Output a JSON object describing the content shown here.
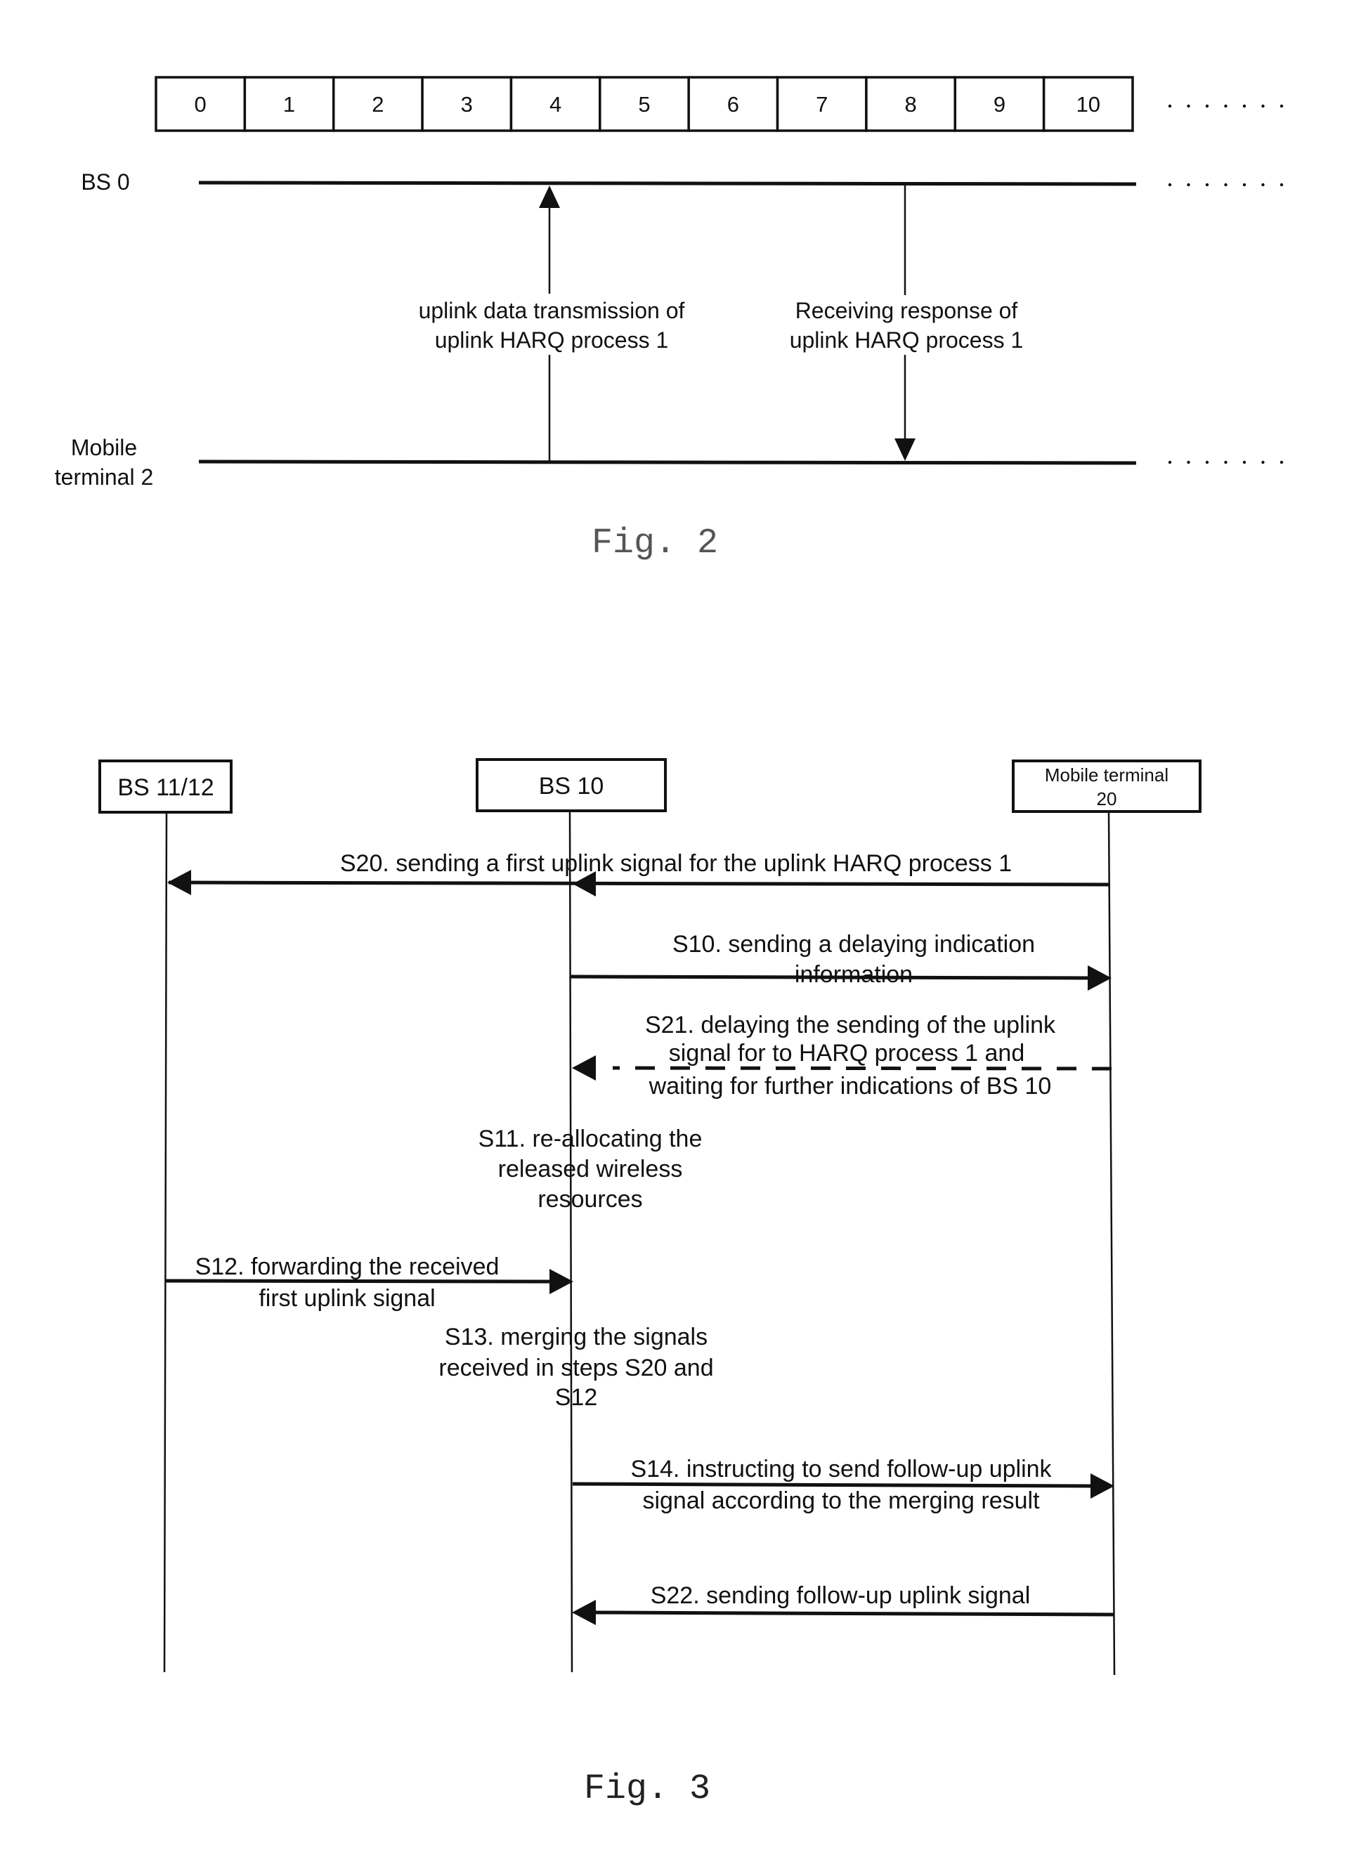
{
  "fig2": {
    "slots": [
      "0",
      "1",
      "2",
      "3",
      "4",
      "5",
      "6",
      "7",
      "8",
      "9",
      "10"
    ],
    "ellipsis": ".......",
    "bs_label": "BS 0",
    "mobile_label": [
      "Mobile",
      "terminal 2"
    ],
    "uplink_label": [
      "uplink data transmission of",
      "uplink  HARQ process 1"
    ],
    "response_label": [
      "Receiving response of",
      "uplink  HARQ process 1"
    ],
    "uplink_slot": 4,
    "response_slot": 8,
    "caption": "Fig. 2"
  },
  "fig3": {
    "entities": [
      {
        "id": "bs1112",
        "label": [
          "BS 11/12"
        ]
      },
      {
        "id": "bs10",
        "label": [
          "BS 10"
        ]
      },
      {
        "id": "mt20",
        "label": [
          "Mobile terminal",
          "20"
        ]
      }
    ],
    "messages": [
      {
        "id": "s20",
        "from": "mt20",
        "to": "bs1112",
        "style": "solid",
        "also_arrow_at": "bs10",
        "text": [
          "S20. sending a first uplink signal for the uplink HARQ process 1"
        ]
      },
      {
        "id": "s10",
        "from": "bs10",
        "to": "mt20",
        "style": "solid",
        "text": [
          "S10.  sending a delaying indication",
          "information"
        ]
      },
      {
        "id": "s21",
        "from": "mt20",
        "to": "bs10",
        "style": "dashed",
        "text": [
          "S21. delaying the sending of the uplink",
          "signal for to HARQ process 1 and",
          "waiting for further indications of BS 10"
        ]
      },
      {
        "id": "s12",
        "from": "bs1112",
        "to": "bs10",
        "style": "solid",
        "text": [
          "S12. forwarding the received",
          "first uplink signal"
        ]
      },
      {
        "id": "s14",
        "from": "bs10",
        "to": "mt20",
        "style": "solid",
        "text": [
          "S14. instructing to send follow-up uplink",
          "signal according to the merging result"
        ]
      },
      {
        "id": "s22",
        "from": "mt20",
        "to": "bs10",
        "style": "solid",
        "text": [
          "S22. sending follow-up uplink signal"
        ]
      }
    ],
    "notes": [
      {
        "id": "s11",
        "text": [
          "S11. re-allocating the",
          "released wireless",
          "resources"
        ]
      },
      {
        "id": "s13",
        "text": [
          "S13. merging the signals",
          "received in steps S20 and",
          "S12"
        ]
      }
    ],
    "caption": "Fig. 3"
  }
}
